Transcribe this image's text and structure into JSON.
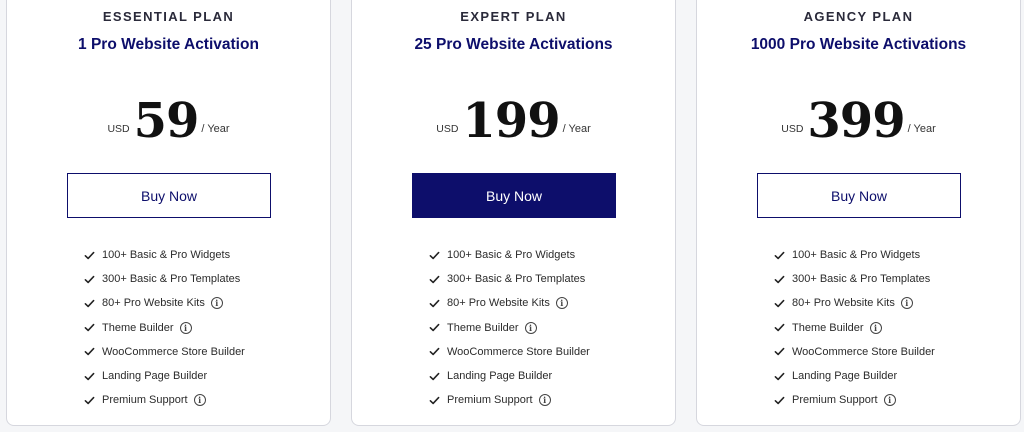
{
  "plans": [
    {
      "name": "ESSENTIAL PLAN",
      "activations": "1 Pro Website Activation",
      "currency": "USD",
      "amount": "59",
      "period": "/ Year",
      "button": "Buy Now",
      "button_style": "outline",
      "features": [
        {
          "label": "100+ Basic & Pro Widgets",
          "info": false
        },
        {
          "label": "300+ Basic & Pro Templates",
          "info": false
        },
        {
          "label": "80+ Pro Website Kits",
          "info": true
        },
        {
          "label": "Theme Builder",
          "info": true
        },
        {
          "label": "WooCommerce Store Builder",
          "info": false
        },
        {
          "label": "Landing Page Builder",
          "info": false
        },
        {
          "label": "Premium Support",
          "info": true
        }
      ]
    },
    {
      "name": "EXPERT PLAN",
      "activations": "25 Pro Website Activations",
      "currency": "USD",
      "amount": "199",
      "period": "/ Year",
      "button": "Buy Now",
      "button_style": "filled",
      "features": [
        {
          "label": "100+ Basic & Pro Widgets",
          "info": false
        },
        {
          "label": "300+ Basic & Pro Templates",
          "info": false
        },
        {
          "label": "80+ Pro Website Kits",
          "info": true
        },
        {
          "label": "Theme Builder",
          "info": true
        },
        {
          "label": "WooCommerce Store Builder",
          "info": false
        },
        {
          "label": "Landing Page Builder",
          "info": false
        },
        {
          "label": "Premium Support",
          "info": true
        }
      ]
    },
    {
      "name": "AGENCY PLAN",
      "activations": "1000 Pro Website Activations",
      "currency": "USD",
      "amount": "399",
      "period": "/ Year",
      "button": "Buy Now",
      "button_style": "outline",
      "features": [
        {
          "label": "100+ Basic & Pro Widgets",
          "info": false
        },
        {
          "label": "300+ Basic & Pro Templates",
          "info": false
        },
        {
          "label": "80+ Pro Website Kits",
          "info": true
        },
        {
          "label": "Theme Builder",
          "info": true
        },
        {
          "label": "WooCommerce Store Builder",
          "info": false
        },
        {
          "label": "Landing Page Builder",
          "info": false
        },
        {
          "label": "Premium Support",
          "info": true
        }
      ]
    }
  ],
  "icons": {
    "check": "check-icon",
    "info": "info-icon"
  },
  "colors": {
    "brand": "#0d0e6b",
    "card_border": "#d6d7de",
    "background": "#f5f6f8"
  }
}
